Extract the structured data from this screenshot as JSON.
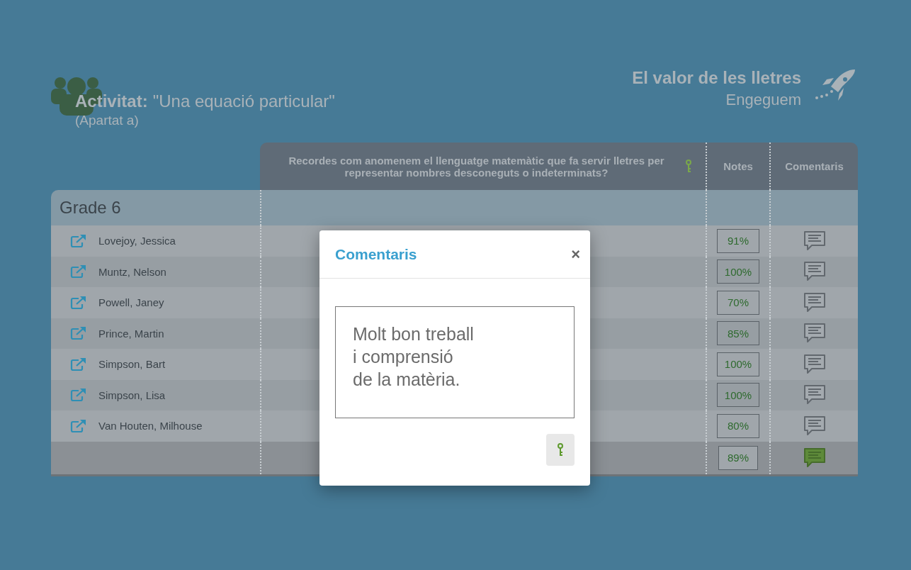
{
  "header": {
    "activity_label": "Activitat:",
    "activity_name": "\"Una equació particular\"",
    "section": "(Apartat a)",
    "course_title": "El valor de les lletres",
    "course_stage": "Engeguem"
  },
  "table": {
    "columns": [
      {
        "label": "Recordes com anomenem el llenguatge matemàtic que fa servir lletres per representar nombres desconeguts o indeterminats?",
        "has_key": true
      },
      {
        "label": "Notes",
        "has_key": false
      },
      {
        "label": "Comentaris",
        "has_key": false
      }
    ],
    "group": "Grade 6",
    "rows": [
      {
        "name": "Lovejoy, Jessica",
        "score": "91%",
        "commented": false
      },
      {
        "name": "Muntz, Nelson",
        "score": "100%",
        "commented": false
      },
      {
        "name": "Powell, Janey",
        "score": "70%",
        "commented": false
      },
      {
        "name": "Prince, Martin",
        "score": "85%",
        "commented": false
      },
      {
        "name": "Simpson, Bart",
        "score": "100%",
        "commented": false
      },
      {
        "name": "Simpson, Lisa",
        "score": "100%",
        "commented": false
      },
      {
        "name": "Van Houten, Milhouse",
        "score": "80%",
        "commented": false
      }
    ],
    "footer": {
      "score": "89%",
      "commented": true
    }
  },
  "modal": {
    "title": "Comentaris",
    "close": "×",
    "comment": "Molt bon treball\ni comprensió\nde la matèria."
  }
}
